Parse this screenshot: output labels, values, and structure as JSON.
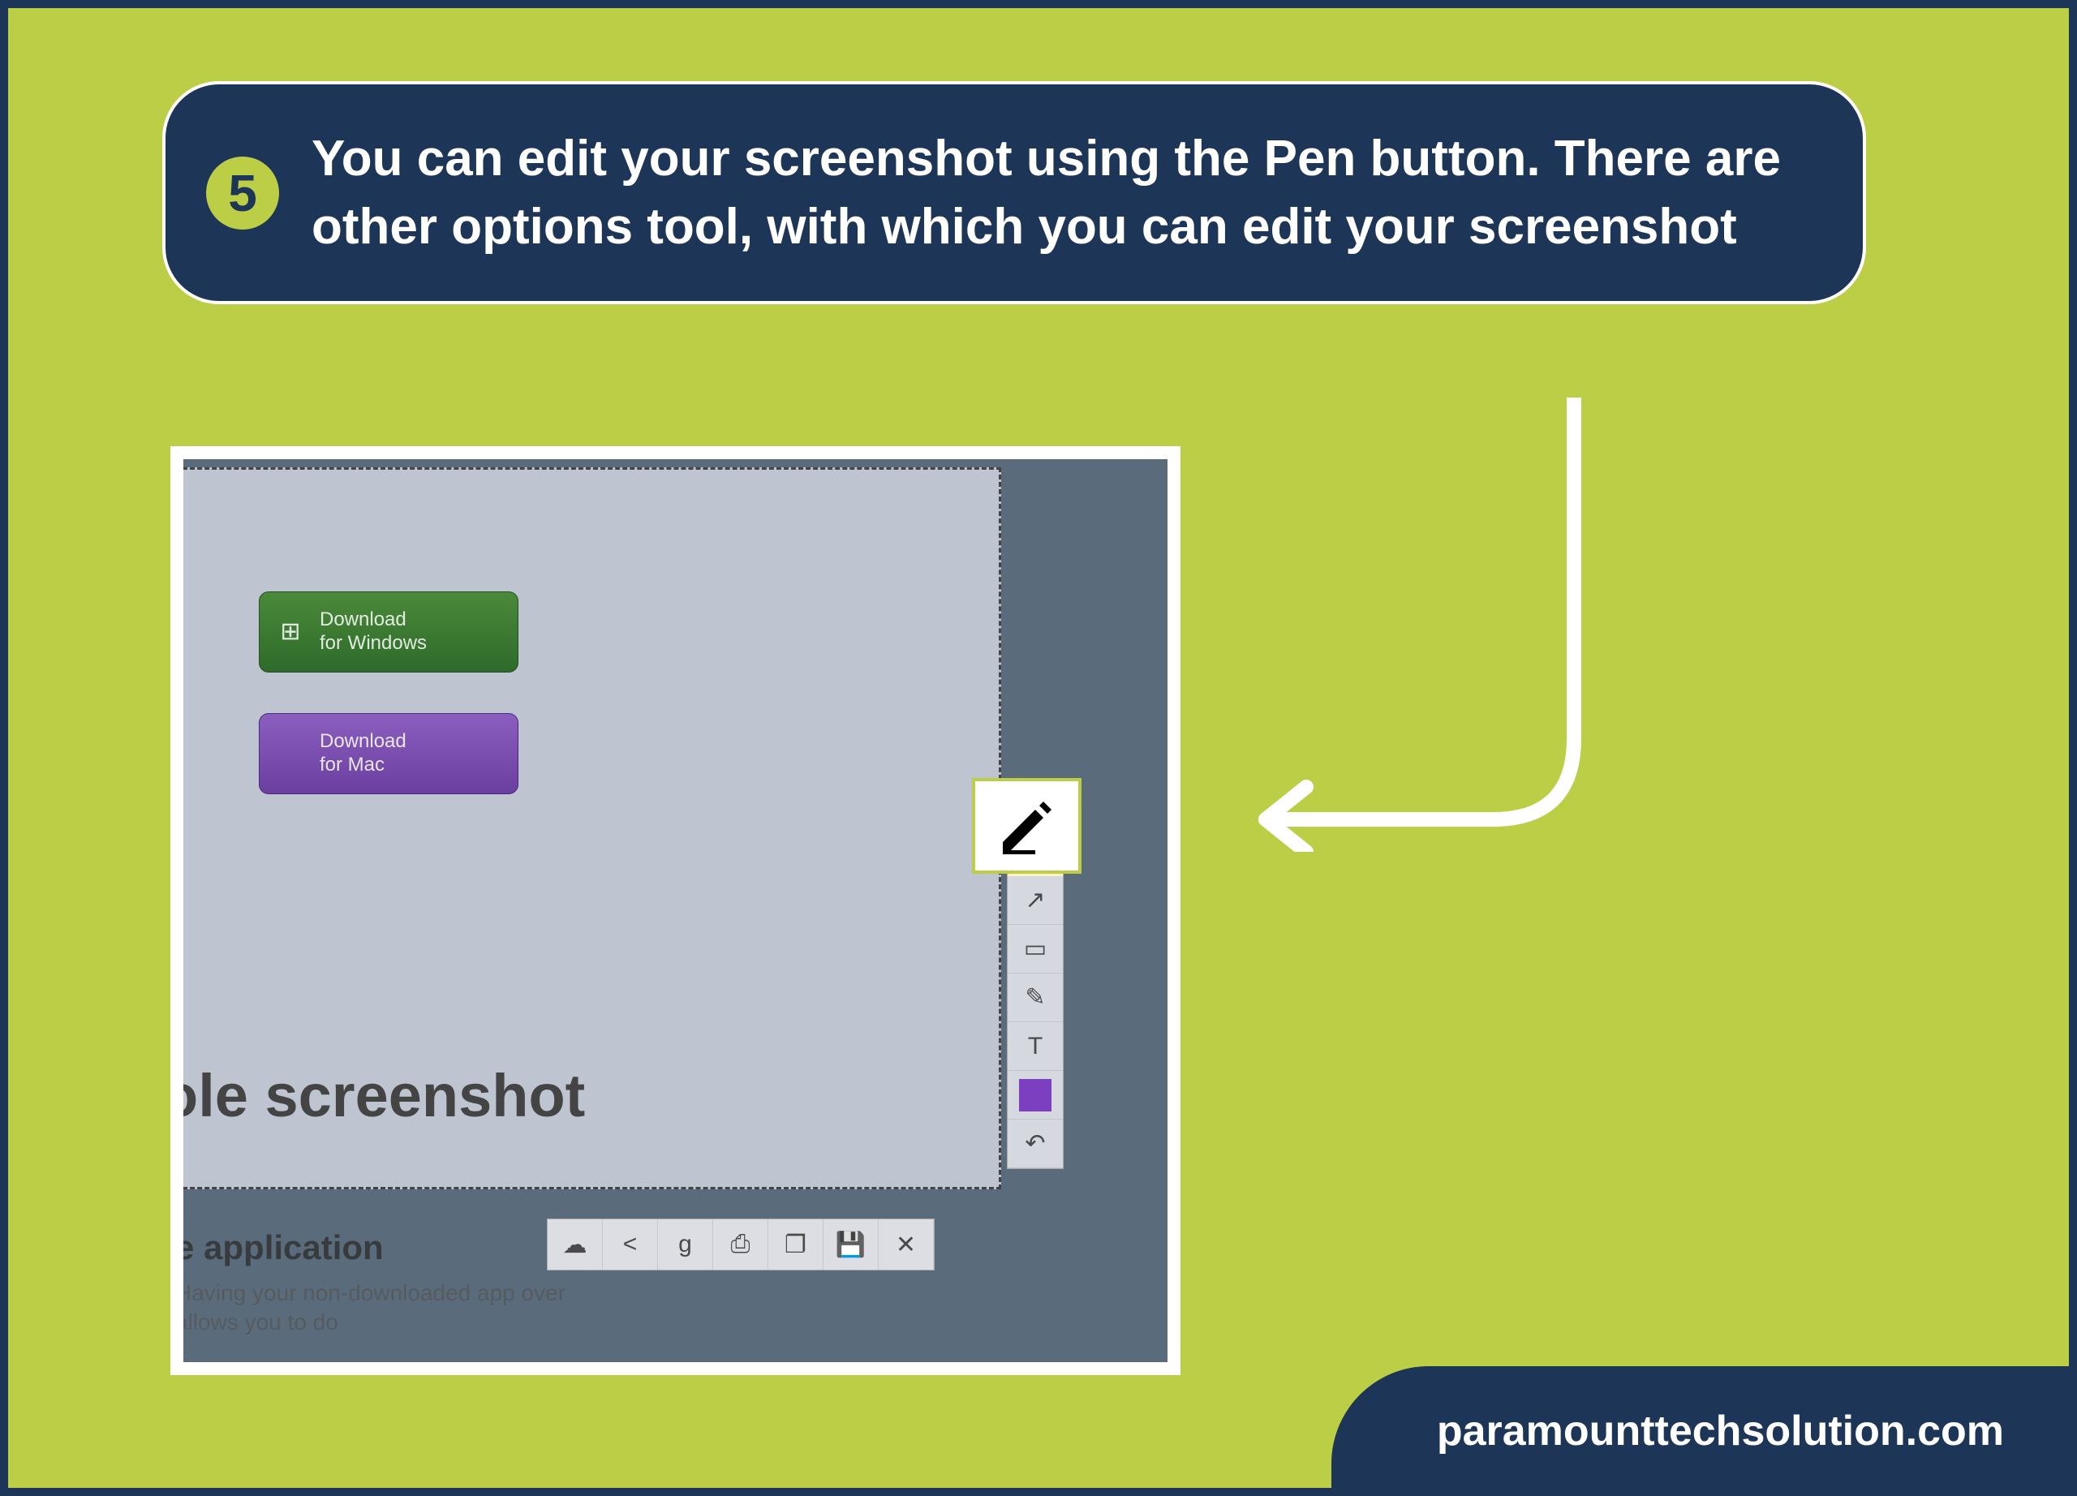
{
  "step": {
    "number": "5",
    "text": "You can edit your screenshot using the Pen button. There are other options tool, with which you can edit your screenshot"
  },
  "screenshot": {
    "download_windows": {
      "line1": "Download",
      "line2": "for Windows"
    },
    "download_mac": {
      "line1": "Download",
      "line2": "for Mac"
    },
    "partial_heading": "ole screenshot",
    "partial_subheading": "e application",
    "partial_desc_line1": "Having your non-downloaded app over",
    "partial_desc_line2": "allows you to do",
    "pen_tooltip": "Pen",
    "side_tools": {
      "arrow": "↗",
      "rectangle": "▭",
      "marker": "✎",
      "text": "T",
      "undo": "↶"
    },
    "bottom_tools": {
      "cloud": "☁",
      "share": "<",
      "google": "g",
      "print": "⎙",
      "copy": "❐",
      "save": "💾",
      "close": "✕"
    }
  },
  "footer": {
    "url": "paramounttechsolution.com"
  }
}
